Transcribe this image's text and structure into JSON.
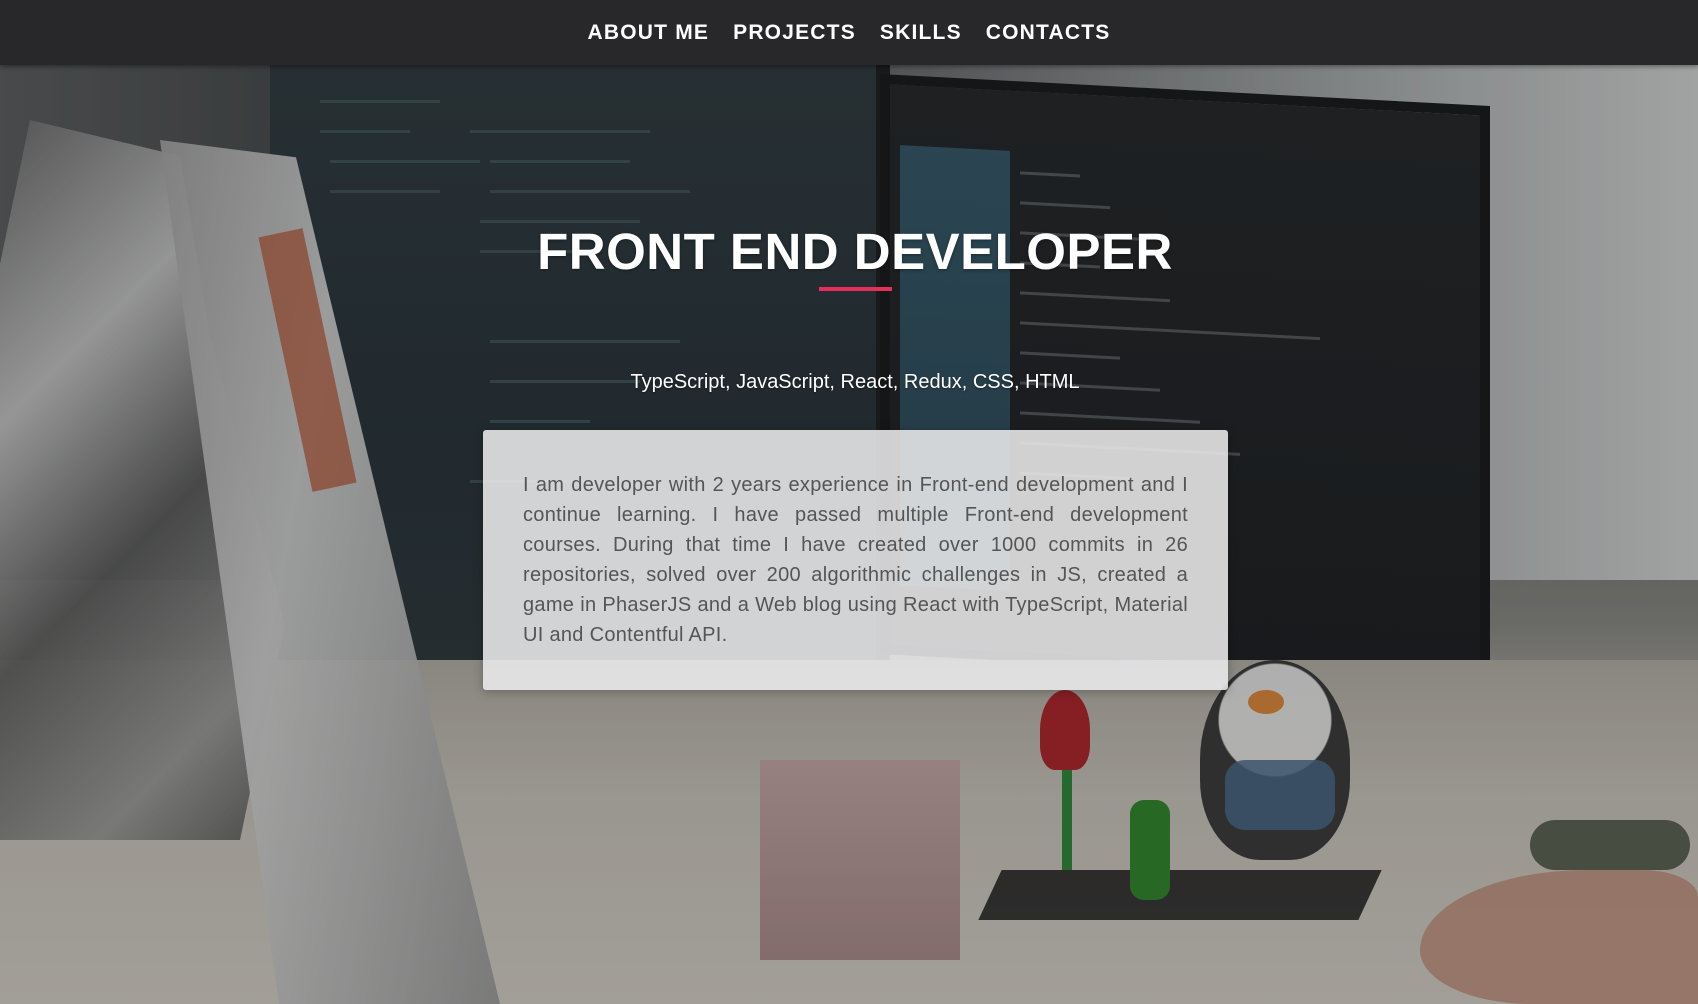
{
  "nav": {
    "items": [
      {
        "label": "ABOUT ME"
      },
      {
        "label": "PROJECTS"
      },
      {
        "label": "SKILLS"
      },
      {
        "label": "CONTACTS"
      }
    ]
  },
  "hero": {
    "title": "FRONT END DEVELOPER",
    "subtitle": "TypeScript, JavaScript, React, Redux, CSS, HTML",
    "about_text": "I am developer with 2 years experience in Front-end development and I continue learning. I have passed multiple Front-end development courses. During that time I have created over 1000 commits in 26 repositories, solved over 200 algorithmic challenges in JS, created a game in PhaserJS and a Web blog using React with TypeScript, Material UI and Contentful API."
  },
  "colors": {
    "navbar_bg": "#28282a",
    "accent": "#e5305d",
    "card_bg": "#ebebec",
    "card_text": "#555555"
  }
}
